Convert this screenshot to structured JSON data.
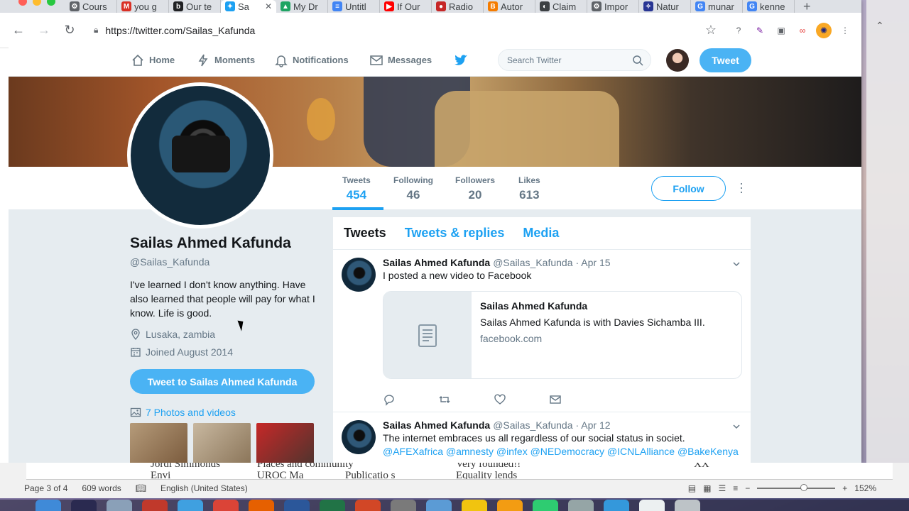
{
  "browser": {
    "tabs": [
      {
        "label": "Cours",
        "icon": "course-icon",
        "color": "#5f6368"
      },
      {
        "label": "you g",
        "icon": "gmail-icon",
        "color": "#d93025"
      },
      {
        "label": "Our te",
        "icon": "bold-b-icon",
        "color": "#202124"
      },
      {
        "label": "Sa",
        "icon": "twitter-icon",
        "color": "#1da1f2",
        "active": true
      },
      {
        "label": "My Dr",
        "icon": "drive-icon",
        "color": "#1fa463"
      },
      {
        "label": "Untitl",
        "icon": "docs-icon",
        "color": "#4285f4"
      },
      {
        "label": "If Our",
        "icon": "youtube-icon",
        "color": "#ff0000"
      },
      {
        "label": "Radio",
        "icon": "radio-icon",
        "color": "#c62828"
      },
      {
        "label": "Autor",
        "icon": "blogger-icon",
        "color": "#f57c00"
      },
      {
        "label": "Claim",
        "icon": "claim-icon",
        "color": "#3c4043"
      },
      {
        "label": "Impor",
        "icon": "import-icon",
        "color": "#5f6368"
      },
      {
        "label": "Natur",
        "icon": "nature-icon",
        "color": "#283593"
      },
      {
        "label": "munar",
        "icon": "google-icon",
        "color": "#4285f4"
      },
      {
        "label": "kenne",
        "icon": "google-icon",
        "color": "#4285f4"
      }
    ],
    "url": "https://twitter.com/Sailas_Kafunda"
  },
  "twitter": {
    "nav": {
      "home": "Home",
      "moments": "Moments",
      "notifications": "Notifications",
      "messages": "Messages",
      "search_placeholder": "Search Twitter",
      "tweet_button": "Tweet"
    },
    "stats": {
      "tweets_label": "Tweets",
      "tweets_value": "454",
      "following_label": "Following",
      "following_value": "46",
      "followers_label": "Followers",
      "followers_value": "20",
      "likes_label": "Likes",
      "likes_value": "613"
    },
    "follow_button": "Follow",
    "profile": {
      "name": "Sailas Ahmed Kafunda",
      "handle": "@Sailas_Kafunda",
      "bio": "I've learned I don't know anything.  Have also learned that people will pay for what I know.  Life is good.",
      "location": "Lusaka, zambia",
      "joined": "Joined August 2014",
      "tweet_to_button": "Tweet to Sailas Ahmed Kafunda",
      "photos_link": "7 Photos and videos"
    },
    "timeline_tabs": [
      "Tweets",
      "Tweets & replies",
      "Media"
    ],
    "tweets": [
      {
        "name": "Sailas Ahmed Kafunda",
        "handle": "@Sailas_Kafunda",
        "date": "· Apr 15",
        "text": "I posted a new video to Facebook",
        "card": {
          "title": "Sailas Ahmed Kafunda",
          "description": "Sailas Ahmed Kafunda is with Davies Sichamba III.",
          "domain": "facebook.com"
        }
      },
      {
        "name": "Sailas Ahmed Kafunda",
        "handle": "@Sailas_Kafunda",
        "date": "· Apr 12",
        "text": "The internet embraces us all regardless of our social status in societ.",
        "mentions": "@AFEXafrica @amnesty @infex @NEDemocracy @ICNLAlliance @BakeKenya"
      }
    ]
  },
  "word": {
    "page": "Page 3 of 4",
    "words": "609 words",
    "language": "English (United States)",
    "zoom": "152%",
    "zoom_level": 0.55,
    "doc_fragments": [
      "Jordi Simmonds",
      "Envi",
      "Places and community",
      "UROC Ma",
      "Publicatio s",
      "Very founded!!",
      "Equality lends",
      "XX"
    ]
  },
  "colors": {
    "twitter_blue": "#1da1f2",
    "button_blue": "#4ab3f4"
  }
}
